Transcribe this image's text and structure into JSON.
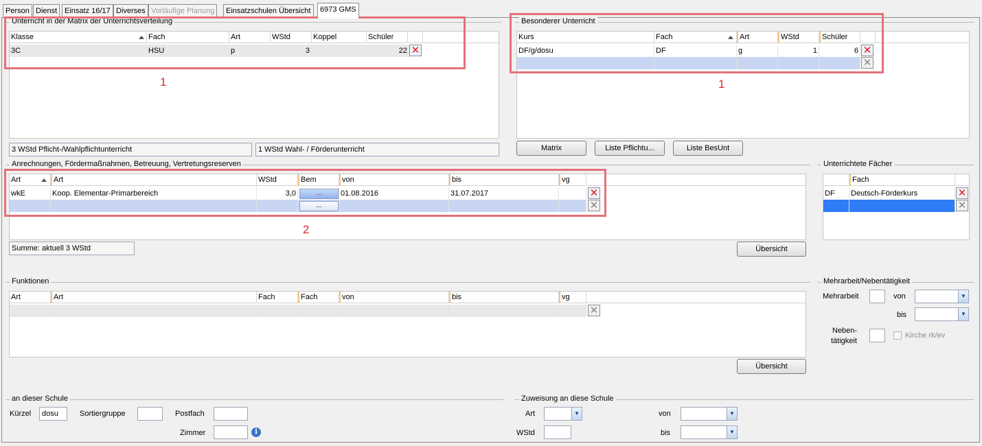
{
  "tabs": [
    "Person",
    "Dienst",
    "Einsatz 16/17",
    "Diverses",
    "Vorläufige Planung",
    "Einsatzschulen Übersicht",
    "6973 GMS"
  ],
  "matrix": {
    "title": "Unterricht in der Matrix der Unterrichtsverteilung",
    "columns": [
      "Klasse",
      "Fach",
      "Art",
      "WStd",
      "Koppel",
      "Schüler"
    ],
    "rows": [
      [
        "3C",
        "HSU",
        "p",
        "3",
        "",
        "22"
      ]
    ],
    "summary1": "3 WStd Pflicht-/Wahlpflichtunterricht",
    "summary2": "1 WStd Wahl- / Förderunterricht"
  },
  "besonderer": {
    "title": "Besonderer Unterricht",
    "columns": [
      "Kurs",
      "Fach",
      "Art",
      "WStd",
      "Schüler"
    ],
    "rows": [
      [
        "DF/g/dosu",
        "DF",
        "g",
        "1",
        "6"
      ]
    ],
    "buttons": [
      "Matrix",
      "Liste Pflichtu...",
      "Liste BesUnt"
    ]
  },
  "annotations": {
    "one_a": "1",
    "one_b": "1",
    "two": "2"
  },
  "anrechnungen": {
    "title": "Anrechnungen, Fördermaßnahmen, Betreuung, Vertretungsreserven",
    "columns": [
      "Art",
      "Art",
      "WStd",
      "Bem",
      "von",
      "bis",
      "vg"
    ],
    "rows": [
      [
        "wkE",
        "Koop. Elementar-Primarbereich",
        "3,0",
        "...",
        "01.08.2016",
        "31.07.2017",
        ""
      ]
    ],
    "dots": "...",
    "summe": "Summe: aktuell 3 WStd",
    "uebersicht": "Übersicht"
  },
  "faecher": {
    "title": "Unterrichtete Fächer",
    "columns": [
      "",
      "Fach"
    ],
    "rows": [
      [
        "DF",
        "Deutsch-Förderkurs"
      ]
    ]
  },
  "funktionen": {
    "title": "Funktionen",
    "columns": [
      "Art",
      "Art",
      "Fach",
      "Fach",
      "von",
      "bis",
      "vg"
    ],
    "uebersicht": "Übersicht"
  },
  "mehrarbeit": {
    "title": "Mehrarbeit/Nebentätigkeit",
    "mehrarbeit": "Mehrarbeit",
    "von": "von",
    "bis": "bis",
    "neben1": "Neben-",
    "neben2": "tätigkeit",
    "kirche": "Kirche rk/ev"
  },
  "schule": {
    "title": "an dieser Schule",
    "kuerzel_label": "Kürzel",
    "kuerzel_value": "dosu",
    "sortiergruppe": "Sortiergruppe",
    "postfach": "Postfach",
    "zimmer": "Zimmer"
  },
  "zuweisung": {
    "title": "Zuweisung an diese Schule",
    "art": "Art",
    "von": "von",
    "wstd": "WStd",
    "bis": "bis"
  }
}
